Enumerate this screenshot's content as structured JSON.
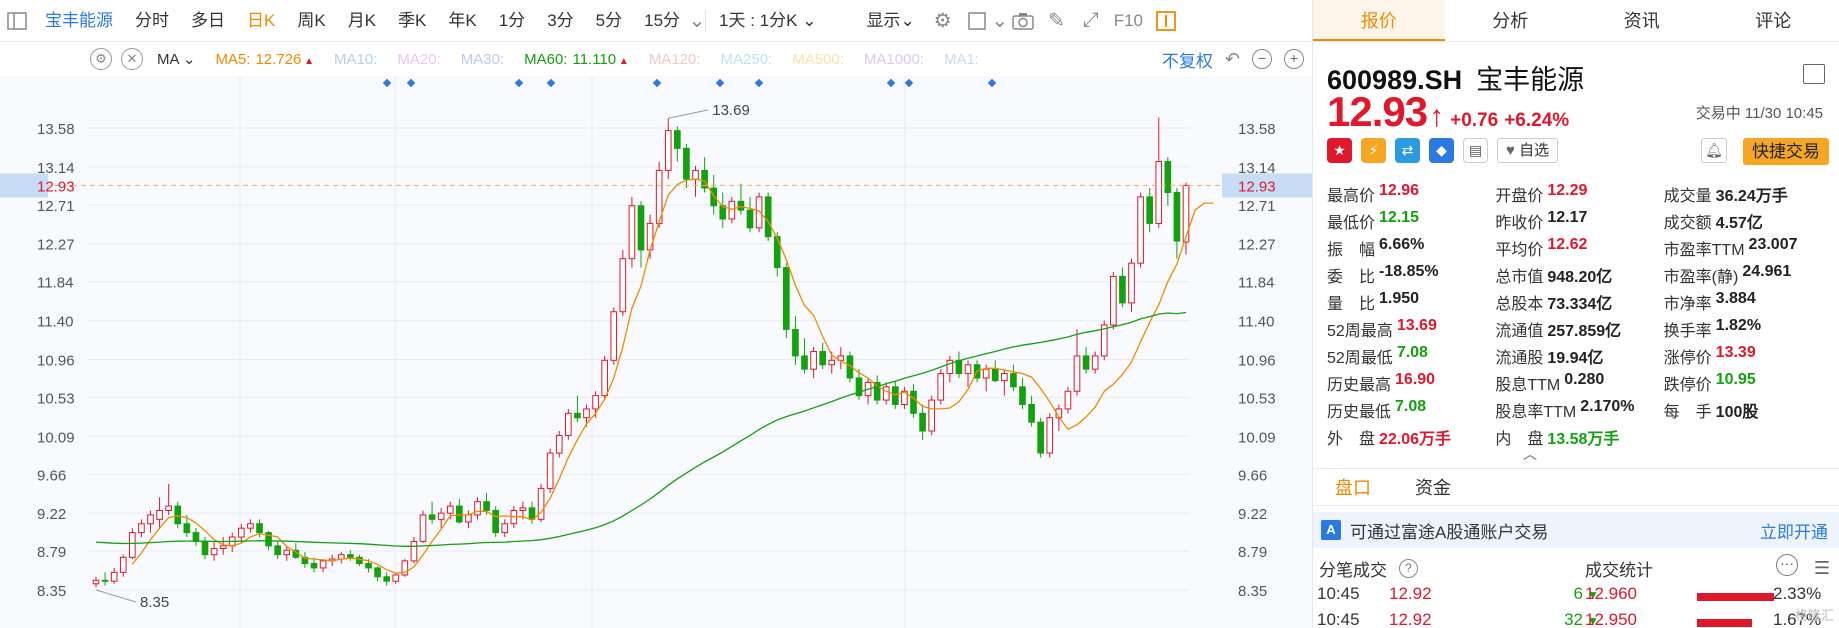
{
  "toolbar": {
    "stock_name": "宝丰能源",
    "periods": [
      "分时",
      "多日",
      "日K",
      "周K",
      "月K",
      "季K",
      "年K",
      "1分",
      "3分",
      "5分",
      "15分"
    ],
    "active_period": "日K",
    "range": "1天 : 1分K",
    "display": "显示",
    "f10": "F10"
  },
  "ma_bar": {
    "selector": "MA",
    "items": [
      {
        "label": "MA5:",
        "value": "12.726",
        "color": "#f08a00",
        "dim": false,
        "up": true
      },
      {
        "label": "MA10:",
        "value": "",
        "color": "#5b9bd5",
        "dim": true,
        "up": false
      },
      {
        "label": "MA20:",
        "value": "",
        "color": "#d67fd6",
        "dim": true,
        "up": false
      },
      {
        "label": "MA30:",
        "value": "",
        "color": "#6b8fd1",
        "dim": true,
        "up": false
      },
      {
        "label": "MA60:",
        "value": "11.110",
        "color": "#13a10e",
        "dim": false,
        "up": true
      },
      {
        "label": "MA120:",
        "value": "",
        "color": "#e58686",
        "dim": true,
        "up": false
      },
      {
        "label": "MA250:",
        "value": "",
        "color": "#5ec8e0",
        "dim": true,
        "up": false
      },
      {
        "label": "MA500:",
        "value": "",
        "color": "#f0c040",
        "dim": true,
        "up": false
      },
      {
        "label": "MA1000:",
        "value": "",
        "color": "#b48cd6",
        "dim": true,
        "up": false
      },
      {
        "label": "MA1:",
        "value": "",
        "color": "#8fb3d9",
        "dim": true,
        "up": false
      }
    ],
    "adjust_link": "不复权"
  },
  "chart_data": {
    "type": "candlestick",
    "ylim": [
      8.3,
      13.85
    ],
    "y_ticks": [
      "13.58",
      "13.14",
      "12.71",
      "12.27",
      "11.84",
      "11.40",
      "10.96",
      "10.53",
      "10.09",
      "9.66",
      "9.22",
      "8.79",
      "8.35"
    ],
    "current_price_label": "12.93",
    "current_price": 12.93,
    "annotations": [
      {
        "text": "13.69",
        "value": 13.69,
        "type": "high"
      },
      {
        "text": "8.35",
        "value": 8.35,
        "type": "low"
      }
    ],
    "colors": {
      "up": "#e0182c",
      "down": "#13a10e",
      "ma5": "#f08a00",
      "ma60": "#13a10e"
    },
    "ohlc": [
      [
        8.42,
        8.5,
        8.38,
        8.46
      ],
      [
        8.46,
        8.55,
        8.4,
        8.45
      ],
      [
        8.45,
        8.6,
        8.42,
        8.55
      ],
      [
        8.55,
        8.75,
        8.5,
        8.72
      ],
      [
        8.72,
        9.05,
        8.7,
        9.0
      ],
      [
        9.0,
        9.15,
        8.95,
        9.1
      ],
      [
        9.1,
        9.25,
        9.0,
        9.2
      ],
      [
        9.15,
        9.4,
        9.05,
        9.25
      ],
      [
        9.25,
        9.55,
        9.2,
        9.3
      ],
      [
        9.3,
        9.35,
        9.05,
        9.1
      ],
      [
        9.1,
        9.2,
        8.95,
        9.0
      ],
      [
        9.0,
        9.05,
        8.85,
        8.9
      ],
      [
        8.9,
        8.95,
        8.7,
        8.75
      ],
      [
        8.75,
        8.9,
        8.68,
        8.82
      ],
      [
        8.82,
        8.95,
        8.75,
        8.85
      ],
      [
        8.85,
        9.0,
        8.78,
        8.95
      ],
      [
        8.95,
        9.1,
        8.88,
        9.05
      ],
      [
        9.05,
        9.15,
        9.0,
        9.1
      ],
      [
        9.1,
        9.15,
        8.95,
        9.0
      ],
      [
        9.0,
        9.02,
        8.8,
        8.85
      ],
      [
        8.85,
        8.9,
        8.7,
        8.75
      ],
      [
        8.75,
        8.85,
        8.68,
        8.8
      ],
      [
        8.8,
        8.88,
        8.7,
        8.72
      ],
      [
        8.72,
        8.78,
        8.6,
        8.65
      ],
      [
        8.65,
        8.72,
        8.55,
        8.6
      ],
      [
        8.6,
        8.7,
        8.55,
        8.68
      ],
      [
        8.68,
        8.75,
        8.62,
        8.7
      ],
      [
        8.7,
        8.78,
        8.65,
        8.75
      ],
      [
        8.75,
        8.8,
        8.68,
        8.72
      ],
      [
        8.72,
        8.75,
        8.62,
        8.65
      ],
      [
        8.65,
        8.7,
        8.55,
        8.6
      ],
      [
        8.6,
        8.62,
        8.45,
        8.5
      ],
      [
        8.5,
        8.55,
        8.4,
        8.45
      ],
      [
        8.45,
        8.55,
        8.42,
        8.52
      ],
      [
        8.52,
        8.7,
        8.5,
        8.68
      ],
      [
        8.68,
        8.95,
        8.65,
        8.9
      ],
      [
        8.9,
        9.25,
        8.88,
        9.2
      ],
      [
        9.2,
        9.35,
        9.1,
        9.15
      ],
      [
        9.15,
        9.28,
        9.05,
        9.22
      ],
      [
        9.22,
        9.35,
        9.15,
        9.3
      ],
      [
        9.3,
        9.38,
        9.1,
        9.12
      ],
      [
        9.12,
        9.25,
        9.05,
        9.2
      ],
      [
        9.2,
        9.4,
        9.15,
        9.35
      ],
      [
        9.35,
        9.45,
        9.2,
        9.25
      ],
      [
        9.25,
        9.3,
        8.95,
        9.0
      ],
      [
        9.0,
        9.15,
        8.95,
        9.1
      ],
      [
        9.1,
        9.3,
        9.05,
        9.25
      ],
      [
        9.25,
        9.35,
        9.15,
        9.28
      ],
      [
        9.28,
        9.35,
        9.1,
        9.15
      ],
      [
        9.15,
        9.55,
        9.12,
        9.5
      ],
      [
        9.5,
        9.95,
        9.45,
        9.9
      ],
      [
        9.9,
        10.15,
        9.85,
        10.1
      ],
      [
        10.1,
        10.4,
        10.05,
        10.35
      ],
      [
        10.35,
        10.55,
        10.25,
        10.3
      ],
      [
        10.3,
        10.45,
        10.2,
        10.4
      ],
      [
        10.4,
        10.6,
        10.3,
        10.55
      ],
      [
        10.55,
        11.0,
        10.5,
        10.95
      ],
      [
        10.95,
        11.55,
        10.9,
        11.5
      ],
      [
        11.5,
        12.2,
        11.45,
        12.1
      ],
      [
        12.1,
        12.8,
        12.0,
        12.7
      ],
      [
        12.7,
        12.75,
        12.0,
        12.2
      ],
      [
        12.2,
        12.6,
        12.1,
        12.5
      ],
      [
        12.5,
        13.2,
        12.45,
        13.1
      ],
      [
        13.1,
        13.69,
        13.0,
        13.55
      ],
      [
        13.55,
        13.6,
        13.2,
        13.35
      ],
      [
        13.35,
        13.4,
        12.9,
        13.0
      ],
      [
        13.0,
        13.15,
        12.8,
        13.1
      ],
      [
        13.1,
        13.25,
        12.85,
        12.9
      ],
      [
        12.9,
        13.05,
        12.6,
        12.7
      ],
      [
        12.7,
        12.85,
        12.45,
        12.55
      ],
      [
        12.55,
        12.8,
        12.5,
        12.75
      ],
      [
        12.75,
        12.95,
        12.6,
        12.65
      ],
      [
        12.65,
        12.8,
        12.4,
        12.45
      ],
      [
        12.45,
        12.85,
        12.4,
        12.8
      ],
      [
        12.8,
        12.85,
        12.3,
        12.35
      ],
      [
        12.35,
        12.4,
        11.9,
        12.0
      ],
      [
        12.0,
        12.05,
        11.2,
        11.3
      ],
      [
        11.3,
        11.45,
        10.9,
        11.0
      ],
      [
        11.0,
        11.2,
        10.8,
        10.85
      ],
      [
        10.85,
        11.1,
        10.75,
        11.05
      ],
      [
        11.05,
        11.15,
        10.85,
        10.9
      ],
      [
        10.9,
        11.05,
        10.8,
        10.95
      ],
      [
        10.95,
        11.1,
        10.85,
        11.0
      ],
      [
        11.0,
        11.05,
        10.7,
        10.75
      ],
      [
        10.75,
        10.85,
        10.5,
        10.55
      ],
      [
        10.55,
        10.75,
        10.45,
        10.7
      ],
      [
        10.7,
        10.78,
        10.45,
        10.5
      ],
      [
        10.5,
        10.7,
        10.45,
        10.65
      ],
      [
        10.65,
        10.72,
        10.4,
        10.45
      ],
      [
        10.45,
        10.65,
        10.4,
        10.6
      ],
      [
        10.6,
        10.68,
        10.3,
        10.35
      ],
      [
        10.35,
        10.45,
        10.05,
        10.15
      ],
      [
        10.15,
        10.55,
        10.1,
        10.5
      ],
      [
        10.5,
        10.85,
        10.45,
        10.8
      ],
      [
        10.8,
        11.0,
        10.7,
        10.95
      ],
      [
        10.95,
        11.05,
        10.75,
        10.8
      ],
      [
        10.8,
        10.95,
        10.65,
        10.9
      ],
      [
        10.9,
        10.95,
        10.7,
        10.75
      ],
      [
        10.75,
        10.9,
        10.6,
        10.85
      ],
      [
        10.85,
        10.95,
        10.7,
        10.72
      ],
      [
        10.72,
        10.85,
        10.55,
        10.8
      ],
      [
        10.8,
        10.9,
        10.6,
        10.65
      ],
      [
        10.65,
        10.75,
        10.4,
        10.45
      ],
      [
        10.45,
        10.55,
        10.2,
        10.25
      ],
      [
        10.25,
        10.3,
        9.85,
        9.9
      ],
      [
        9.9,
        10.35,
        9.85,
        10.3
      ],
      [
        10.3,
        10.45,
        10.15,
        10.4
      ],
      [
        10.4,
        10.65,
        10.35,
        10.6
      ],
      [
        10.6,
        11.3,
        10.55,
        11.0
      ],
      [
        11.0,
        11.1,
        10.8,
        10.85
      ],
      [
        10.85,
        11.05,
        10.8,
        11.0
      ],
      [
        11.0,
        11.4,
        10.95,
        11.35
      ],
      [
        11.35,
        11.95,
        11.3,
        11.9
      ],
      [
        11.9,
        12.0,
        11.55,
        11.6
      ],
      [
        11.6,
        12.1,
        11.5,
        12.05
      ],
      [
        12.05,
        12.85,
        12.0,
        12.8
      ],
      [
        12.8,
        12.9,
        12.4,
        12.5
      ],
      [
        12.5,
        13.7,
        12.45,
        13.2
      ],
      [
        13.2,
        13.25,
        12.7,
        12.85
      ],
      [
        12.85,
        12.9,
        12.1,
        12.3
      ],
      [
        12.29,
        12.96,
        12.15,
        12.93
      ]
    ],
    "ma5": [
      null,
      null,
      null,
      null,
      8.64,
      8.77,
      8.92,
      9.05,
      9.17,
      9.19,
      9.17,
      9.11,
      9.02,
      8.92,
      8.86,
      8.85,
      8.88,
      8.95,
      8.99,
      8.97,
      8.95,
      8.84,
      8.78,
      8.71,
      8.7,
      8.69,
      8.68,
      8.7,
      8.71,
      8.7,
      8.68,
      8.64,
      8.58,
      8.54,
      8.55,
      8.61,
      8.75,
      8.9,
      9.04,
      9.19,
      9.2,
      9.2,
      9.24,
      9.24,
      9.18,
      9.19,
      9.18,
      9.18,
      9.14,
      9.23,
      9.39,
      9.61,
      9.85,
      10.05,
      10.23,
      10.35,
      10.51,
      10.75,
      11.1,
      11.54,
      11.79,
      12.2,
      12.52,
      12.82,
      12.94,
      12.99,
      13.0,
      12.98,
      12.81,
      12.69,
      12.66,
      12.69,
      12.67,
      12.64,
      12.52,
      12.33,
      12.09,
      11.8,
      11.57,
      11.46,
      11.22,
      11.01,
      10.94,
      10.89,
      10.81,
      10.75,
      10.66,
      10.6,
      10.56,
      10.59,
      10.52,
      10.43,
      10.4,
      10.4,
      10.41,
      10.48,
      10.62,
      10.83,
      10.86,
      10.86,
      10.84,
      10.82,
      10.8,
      10.76,
      10.63,
      10.48,
      10.31,
      10.17,
      10.22,
      10.31,
      10.42,
      10.6,
      10.68,
      10.79,
      10.93,
      11.16,
      11.38,
      11.58,
      11.84,
      12.04,
      12.35,
      12.65,
      12.73,
      12.73
    ]
  },
  "panel": {
    "tabs": [
      "报价",
      "分析",
      "资讯",
      "评论"
    ],
    "active_tab": "报价",
    "code": "600989.SH",
    "name": "宝丰能源",
    "price": "12.93",
    "change": "+0.76",
    "change_pct": "+6.24%",
    "trade_status": "交易中 11/30 10:45",
    "watch_btn": "自选",
    "fast_trade": "快捷交易",
    "quotes": [
      [
        {
          "k": "最高价",
          "v": "12.96",
          "c": "red"
        },
        {
          "k": "开盘价",
          "v": "12.29",
          "c": "red"
        },
        {
          "k": "成交量",
          "v": "36.24万手",
          "c": ""
        }
      ],
      [
        {
          "k": "最低价",
          "v": "12.15",
          "c": "green"
        },
        {
          "k": "昨收价",
          "v": "12.17",
          "c": ""
        },
        {
          "k": "成交额",
          "v": "4.57亿",
          "c": ""
        }
      ],
      [
        {
          "k": "振　幅",
          "v": "6.66%",
          "c": ""
        },
        {
          "k": "平均价",
          "v": "12.62",
          "c": "red"
        },
        {
          "k": "市盈率TTM",
          "v": "23.007",
          "c": ""
        }
      ],
      [
        {
          "k": "委　比",
          "v": "-18.85%",
          "c": ""
        },
        {
          "k": "总市值",
          "v": "948.20亿",
          "c": ""
        },
        {
          "k": "市盈率(静)",
          "v": "24.961",
          "c": ""
        }
      ],
      [
        {
          "k": "量　比",
          "v": "1.950",
          "c": ""
        },
        {
          "k": "总股本",
          "v": "73.334亿",
          "c": ""
        },
        {
          "k": "市净率",
          "v": "3.884",
          "c": ""
        }
      ],
      [
        {
          "k": "52周最高",
          "v": "13.69",
          "c": "red"
        },
        {
          "k": "流通值",
          "v": "257.859亿",
          "c": ""
        },
        {
          "k": "换手率",
          "v": "1.82%",
          "c": ""
        }
      ],
      [
        {
          "k": "52周最低",
          "v": "7.08",
          "c": "green"
        },
        {
          "k": "流通股",
          "v": "19.94亿",
          "c": ""
        },
        {
          "k": "涨停价",
          "v": "13.39",
          "c": "red"
        }
      ],
      [
        {
          "k": "历史最高",
          "v": "16.90",
          "c": "red"
        },
        {
          "k": "股息TTM",
          "v": "0.280",
          "c": ""
        },
        {
          "k": "跌停价",
          "v": "10.95",
          "c": "green"
        }
      ],
      [
        {
          "k": "历史最低",
          "v": "7.08",
          "c": "green"
        },
        {
          "k": "股息率TTM",
          "v": "2.170%",
          "c": ""
        },
        {
          "k": "每　手",
          "v": "100股",
          "c": ""
        }
      ],
      [
        {
          "k": "外　盘",
          "v": "22.06万手",
          "c": "red"
        },
        {
          "k": "内　盘",
          "v": "13.58万手",
          "c": "green"
        },
        {
          "k": "",
          "v": "",
          "c": ""
        }
      ]
    ],
    "subtabs": [
      "盘口",
      "资金"
    ],
    "active_subtab": "盘口",
    "banner_text": "可通过富途A股通账户交易",
    "banner_link": "立即开通",
    "ticks_title": "分笔成交",
    "stats_title": "成交统计",
    "ticks": [
      {
        "time": "10:45",
        "price": "12.92",
        "vol": "6"
      },
      {
        "time": "10:45",
        "price": "12.92",
        "vol": "32"
      }
    ],
    "stats": [
      {
        "price": "12.960",
        "pct": "2.33%",
        "ratio": 0.0233
      },
      {
        "price": "12.950",
        "pct": "1.67%",
        "ratio": 0.0167
      }
    ],
    "watermark": "格隆汇"
  }
}
